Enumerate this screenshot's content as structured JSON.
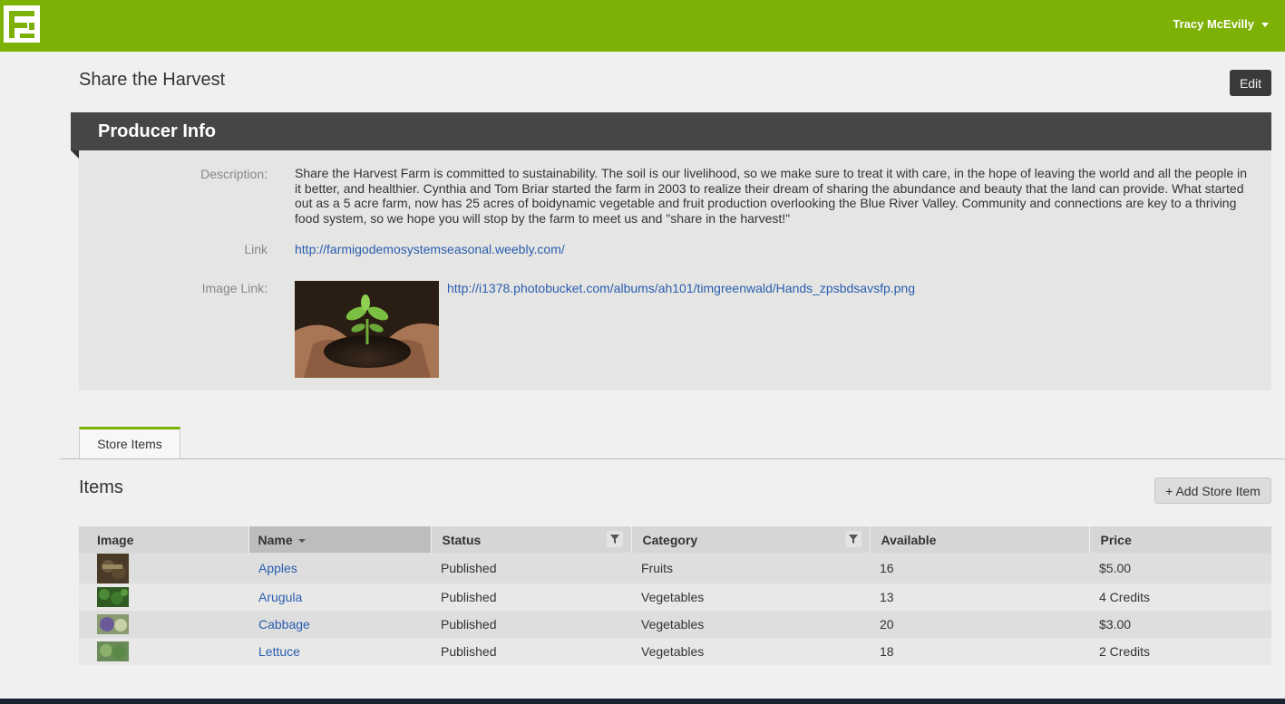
{
  "header": {
    "user_name": "Tracy McEvilly",
    "user_menu_icon": "chevron-down-icon",
    "logo_icon": "farmigo-logo-icon"
  },
  "colors": {
    "brand_green": "#7db106",
    "header_dark": "#464646"
  },
  "page": {
    "title": "Share the Harvest",
    "edit_label": "Edit"
  },
  "producer": {
    "section_title": "Producer Info",
    "description_label": "Description:",
    "description": "Share the Harvest Farm is committed to sustainability. The soil is our livelihood, so we make sure to treat it with care, in the hope of leaving the world and all the people in it better, and healthier. Cynthia and Tom Briar started the farm in 2003 to realize their dream of sharing the abundance and beauty that the land can provide. What started out as a 5 acre farm, now has 25 acres of boidynamic vegetable and fruit production overlooking the Blue River Valley. Community and connections are key to a thriving food system, so we hope you will stop by the farm to meet us and \"share in the harvest!\"",
    "link_label": "Link",
    "link": "http://farmigodemosystemseasonal.weebly.com/",
    "image_link_label": "Image Link:",
    "image_link": "http://i1378.photobucket.com/albums/ah101/timgreenwald/Hands_zpsbdsavsfp.png"
  },
  "tabs": [
    {
      "label": "Store Items",
      "active": true
    }
  ],
  "items": {
    "title": "Items",
    "add_label": "+ Add Store Item",
    "columns": [
      "Image",
      "Name",
      "Status",
      "Category",
      "Available",
      "Price"
    ],
    "sorted_column": "Name",
    "filter_icon": "filter-icon",
    "rows": [
      {
        "name": "Apples",
        "status": "Published",
        "category": "Fruits",
        "available": "16",
        "price": "$5.00"
      },
      {
        "name": "Arugula",
        "status": "Published",
        "category": "Vegetables",
        "available": "13",
        "price": "4 Credits"
      },
      {
        "name": "Cabbage",
        "status": "Published",
        "category": "Vegetables",
        "available": "20",
        "price": "$3.00"
      },
      {
        "name": "Lettuce",
        "status": "Published",
        "category": "Vegetables",
        "available": "18",
        "price": "2 Credits"
      }
    ]
  }
}
